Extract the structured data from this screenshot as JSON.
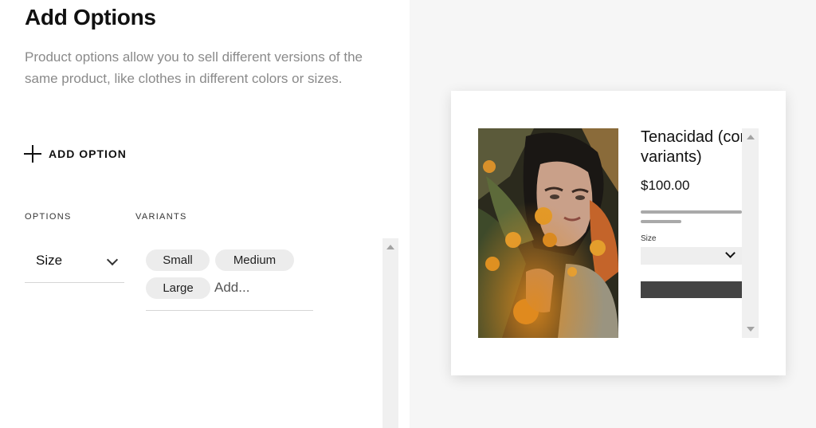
{
  "panel": {
    "title": "Add Options",
    "description": "Product options allow you to sell different versions of the same product, like clothes in different colors or sizes.",
    "add_option_label": "ADD OPTION",
    "columns": {
      "options": "OPTIONS",
      "variants": "VARIANTS"
    },
    "option": {
      "name": "Size",
      "icon": "chevron-down-icon"
    },
    "variants": [
      "Small",
      "Medium",
      "Large"
    ],
    "add_variant_placeholder": "Add..."
  },
  "preview": {
    "product_title": "Tenacidad (con variants)",
    "price": "$100.00",
    "size_label": "Size",
    "image_icon": "product-artwork"
  },
  "colors": {
    "preview_background": "#f6f6f6",
    "chip_background": "#ececec",
    "button_dark": "#444444"
  }
}
